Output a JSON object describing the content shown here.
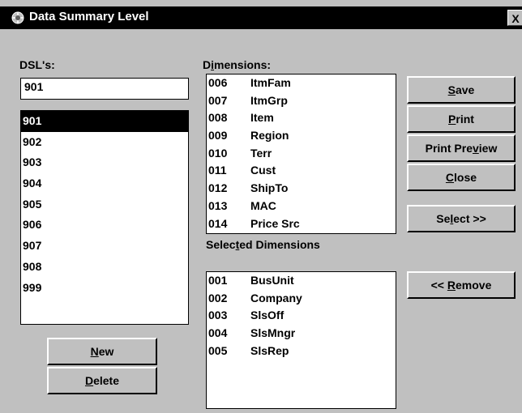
{
  "window": {
    "title": "Data Summary Level",
    "close_label": "X"
  },
  "dsl": {
    "label": "DSL's:",
    "input_value": "901",
    "items": [
      "901",
      "902",
      "903",
      "904",
      "905",
      "906",
      "907",
      "908",
      "999"
    ],
    "selected": "901"
  },
  "dimensions": {
    "label_prefix": "D",
    "label_accel": "i",
    "label_rest": "mensions:",
    "items": [
      {
        "code": "006",
        "name": "ItmFam"
      },
      {
        "code": "007",
        "name": "ItmGrp"
      },
      {
        "code": "008",
        "name": "Item"
      },
      {
        "code": "009",
        "name": "Region"
      },
      {
        "code": "010",
        "name": "Terr"
      },
      {
        "code": "011",
        "name": "Cust"
      },
      {
        "code": "012",
        "name": "ShipTo"
      },
      {
        "code": "013",
        "name": "MAC"
      },
      {
        "code": "014",
        "name": "Price Src"
      }
    ]
  },
  "selected_dimensions": {
    "label_prefix": "Selec",
    "label_accel": "t",
    "label_rest": "ed Dimensions",
    "items": [
      {
        "code": "001",
        "name": "BusUnit"
      },
      {
        "code": "002",
        "name": "Company"
      },
      {
        "code": "003",
        "name": "SlsOff"
      },
      {
        "code": "004",
        "name": "SlsMngr"
      },
      {
        "code": "005",
        "name": "SlsRep"
      }
    ]
  },
  "buttons": {
    "save": {
      "accel": "S",
      "rest": "ave"
    },
    "print": {
      "accel": "P",
      "rest": "rint"
    },
    "print_preview": {
      "pre": "Print Pre",
      "accel": "v",
      "rest": "iew"
    },
    "close": {
      "accel": "C",
      "rest": "lose"
    },
    "select": {
      "pre": "Se",
      "accel": "l",
      "rest": "ect >>"
    },
    "remove": {
      "pre": "<< ",
      "accel": "R",
      "rest": "emove"
    },
    "new": {
      "accel": "N",
      "rest": "ew"
    },
    "delete": {
      "accel": "D",
      "rest": "elete"
    }
  }
}
